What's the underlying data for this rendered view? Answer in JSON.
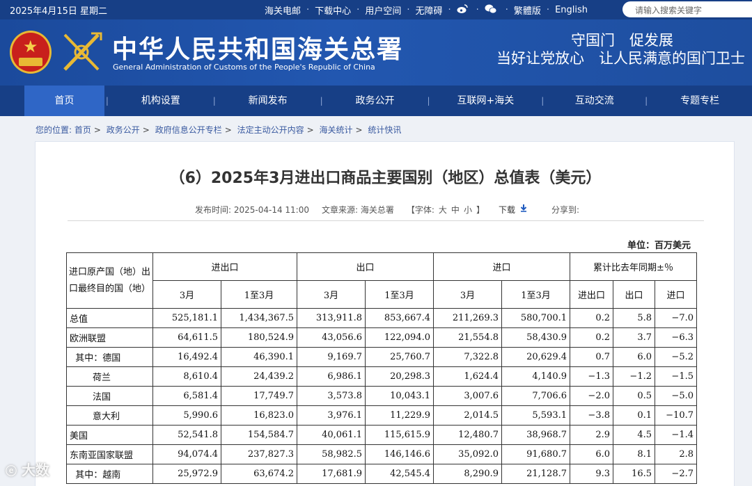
{
  "topbar": {
    "date": "2025年4月15日 星期二",
    "links": [
      "海关电邮",
      "下载中心",
      "用户空间",
      "无障碍"
    ],
    "weibo_icon": "weibo-icon",
    "wechat_icon": "wechat-icon",
    "traditional": "繁體版",
    "english": "English",
    "search_placeholder": "请输入搜索关键字"
  },
  "header": {
    "title_cn": "中华人民共和国海关总署",
    "title_en": "General Administration of Customs of the People's Republic of China",
    "slogan_line1": "守国门　促发展",
    "slogan_line2": "当好让党放心　让人民满意的国门卫士"
  },
  "nav": {
    "items": [
      "首页",
      "机构设置",
      "新闻发布",
      "政务公开",
      "互联网+海关",
      "互动交流",
      "专题专栏"
    ],
    "separator": "|"
  },
  "breadcrumb": {
    "prefix": "您的位置:",
    "items": [
      "首页",
      "政务公开",
      "政府信息公开专栏",
      "法定主动公开内容",
      "海关统计",
      "统计快讯"
    ],
    "separator": ">"
  },
  "article": {
    "title": "（6）2025年3月进出口商品主要国别（地区）总值表（美元）",
    "publish_time": "发布时间:  2025-04-14 11:00",
    "source": "文章来源:  海关总署",
    "font_label": "【字体:",
    "font_large": "大",
    "font_medium": "中",
    "font_small": "小",
    "font_close": "】",
    "download": "下载",
    "share": "分享到:",
    "unit": "单位：百万美元"
  },
  "table": {
    "header_country": "进口原产国（地）出口最终目的国（地）",
    "groups": [
      "进出口",
      "出口",
      "进口",
      "累计比去年同期±％"
    ],
    "subheaders": [
      "3月",
      "1至3月",
      "3月",
      "1至3月",
      "3月",
      "1至3月",
      "进出口",
      "出口",
      "进口"
    ],
    "rows": [
      {
        "name": "总值",
        "values": [
          "525,181.1",
          "1,434,367.5",
          "313,911.8",
          "853,667.4",
          "211,269.3",
          "580,700.1",
          "0.2",
          "5.8",
          "−7.0"
        ]
      },
      {
        "name": "欧洲联盟",
        "values": [
          "64,611.5",
          "180,524.9",
          "43,056.6",
          "122,094.0",
          "21,554.8",
          "58,430.9",
          "0.2",
          "3.7",
          "−6.3"
        ]
      },
      {
        "name": "  其中：德国",
        "values": [
          "16,492.4",
          "46,390.1",
          "9,169.7",
          "25,760.7",
          "7,322.8",
          "20,629.4",
          "0.7",
          "6.0",
          "−5.2"
        ]
      },
      {
        "name": "        荷兰",
        "values": [
          "8,610.4",
          "24,439.2",
          "6,986.1",
          "20,298.3",
          "1,624.4",
          "4,140.9",
          "−1.3",
          "−1.2",
          "−1.5"
        ]
      },
      {
        "name": "        法国",
        "values": [
          "6,581.4",
          "17,749.7",
          "3,573.8",
          "10,043.1",
          "3,007.6",
          "7,706.6",
          "−2.0",
          "0.5",
          "−5.0"
        ]
      },
      {
        "name": "        意大利",
        "values": [
          "5,990.6",
          "16,823.0",
          "3,976.1",
          "11,229.9",
          "2,014.5",
          "5,593.1",
          "−3.8",
          "0.1",
          "−10.7"
        ]
      },
      {
        "name": "美国",
        "values": [
          "52,541.8",
          "154,584.7",
          "40,061.1",
          "115,615.9",
          "12,480.7",
          "38,968.7",
          "2.9",
          "4.5",
          "−1.4"
        ]
      },
      {
        "name": "东南亚国家联盟",
        "values": [
          "94,074.4",
          "237,827.3",
          "58,982.5",
          "146,146.6",
          "35,092.0",
          "91,680.7",
          "6.0",
          "8.1",
          "2.8"
        ]
      },
      {
        "name": "  其中：越南",
        "values": [
          "25,972.9",
          "63,674.2",
          "17,681.9",
          "42,545.4",
          "8,290.9",
          "21,128.7",
          "9.3",
          "16.5",
          "−2.7"
        ]
      }
    ]
  },
  "watermark": "大数",
  "colors": {
    "topbar": "#173f86",
    "header": "#1f52a8",
    "nav_active": "#2f66c6",
    "link": "#3a5aa0"
  }
}
